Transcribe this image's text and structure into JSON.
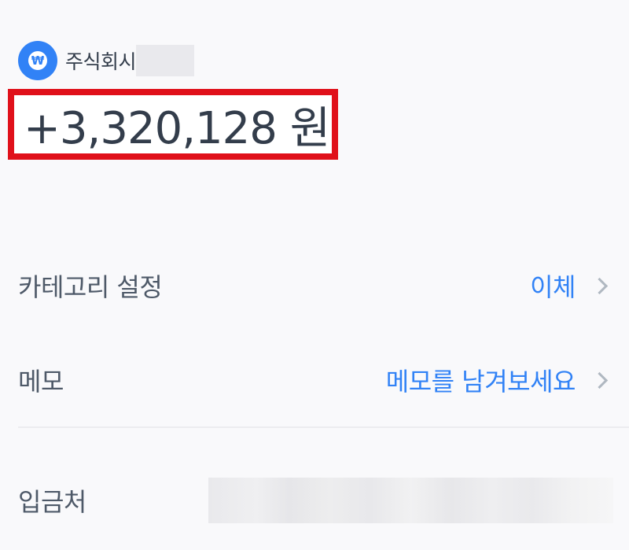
{
  "header": {
    "logo_icon": "won-icon",
    "logo_glyph": "₩",
    "company_name": "주식회시"
  },
  "amount": {
    "text": "+3,320,128 원"
  },
  "rows": {
    "category": {
      "label": "카테고리 설정",
      "value": "이체"
    },
    "memo": {
      "label": "메모",
      "value": "메모를 남겨보세요"
    },
    "depositor": {
      "label": "입금처"
    }
  },
  "colors": {
    "accent": "#3182f6",
    "highlight_border": "#e0101a",
    "text_primary": "#333d4b",
    "background": "#f9f9fb"
  }
}
